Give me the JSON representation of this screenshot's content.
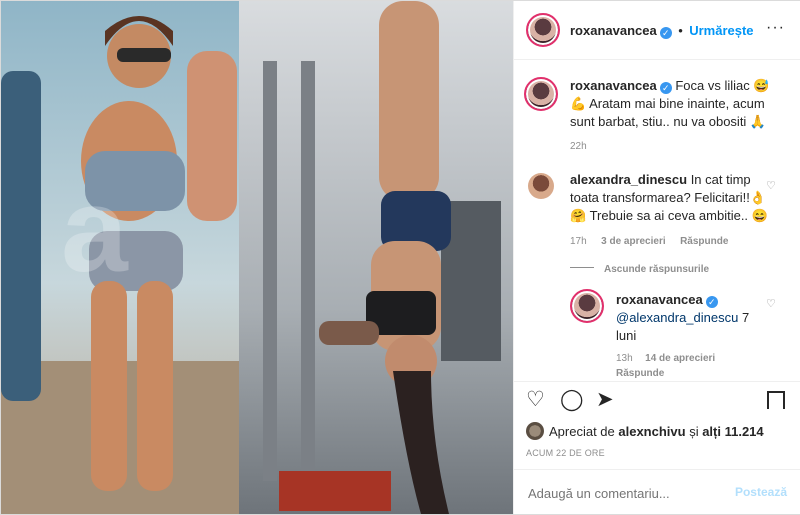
{
  "header": {
    "username": "roxanavancea",
    "follow_label": "Urmărește",
    "more_label": "···"
  },
  "caption": {
    "username": "roxanavancea",
    "text": "Foca vs liliac 😅💪 Aratam mai bine inainte, acum sunt barbat, stiu.. nu va obositi 🙏",
    "time": "22h"
  },
  "comments": [
    {
      "username": "alexandra_dinescu",
      "text": "In cat timp toata transformarea? Felicitari!!👌🤗 Trebuie sa ai ceva ambitie.. 😄",
      "time": "17h",
      "likes": "3 de aprecieri",
      "reply_label": "Răspunde"
    }
  ],
  "hide_replies_label": "Ascunde răspunsurile",
  "reply": {
    "username": "roxanavancea",
    "mention": "@alexandra_dinescu",
    "text": " 7 luni",
    "time": "13h",
    "likes": "14 de aprecieri",
    "reply_label": "Răspunde"
  },
  "likes_line": {
    "prefix": "Apreciat de ",
    "user": "alexnchivu",
    "middle": " și ",
    "others": "alți 11.214"
  },
  "post_time": "ACUM 22 DE ORE",
  "add_comment": {
    "placeholder": "Adaugă un comentariu...",
    "post_label": "Postează"
  },
  "colors": {
    "accent": "#0095f6",
    "muted": "#8e8e8e",
    "verified": "#3897f0"
  },
  "icons": [
    "heart-icon",
    "comment-icon",
    "share-icon",
    "bookmark-icon",
    "more-icon",
    "emoji-icon"
  ]
}
